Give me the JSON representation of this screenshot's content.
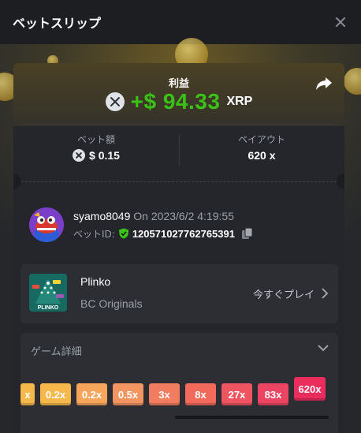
{
  "header": {
    "title": "ベットスリップ"
  },
  "summary": {
    "profit_label": "利益",
    "profit_amount": "+$ 94.33",
    "currency": "XRP",
    "bet_label": "ベット額",
    "bet_amount": "$ 0.15",
    "payout_label": "ペイアウト",
    "payout_value": "620 x"
  },
  "user": {
    "name": "syamo8049",
    "on_label": "On",
    "datetime": "2023/6/2 4:19:55",
    "bet_id_label": "ベットID:",
    "bet_id": "120571027762765391"
  },
  "game": {
    "name": "Plinko",
    "provider": "BC Originals",
    "play_label": "今すぐプレイ",
    "thumb_label": "PLINKO"
  },
  "details": {
    "title": "ゲーム詳細",
    "multipliers": [
      {
        "label": "x",
        "color": "#f7b84b"
      },
      {
        "label": "0.2x",
        "color": "#f7b84b"
      },
      {
        "label": "0.2x",
        "color": "#f6a55a"
      },
      {
        "label": "0.5x",
        "color": "#f39561"
      },
      {
        "label": "3x",
        "color": "#f27c5f"
      },
      {
        "label": "8x",
        "color": "#f26a5c"
      },
      {
        "label": "27x",
        "color": "#ee5560"
      },
      {
        "label": "83x",
        "color": "#ec4563"
      },
      {
        "label": "620x",
        "color": "#ea2d5d"
      }
    ]
  },
  "colors": {
    "profit_green": "#3bc117",
    "verified_green": "#3bc117",
    "panel": "#2c2e33",
    "header": "#1c1e22"
  }
}
